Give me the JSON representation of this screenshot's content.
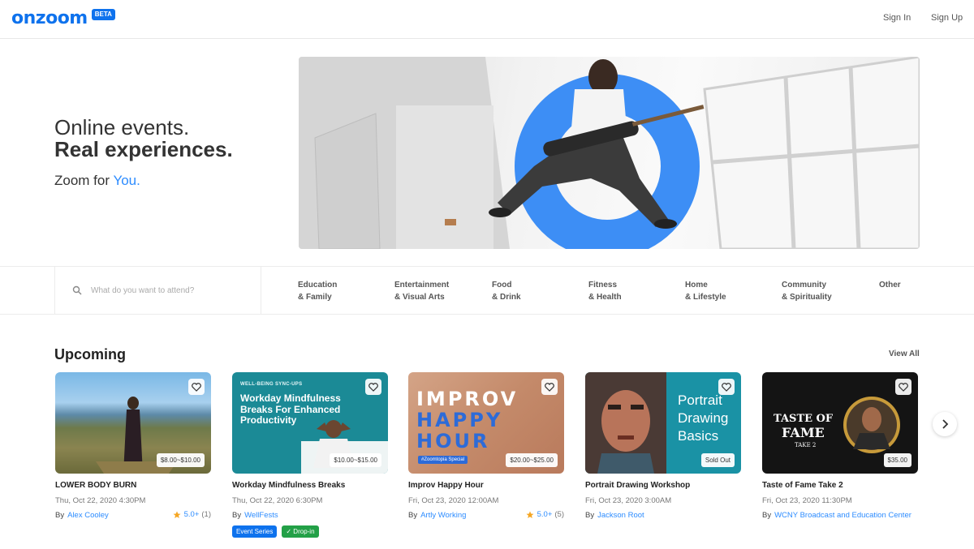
{
  "header": {
    "logo": "onzoom",
    "beta": "BETA",
    "sign_in": "Sign In",
    "sign_up": "Sign Up"
  },
  "hero": {
    "line1": "Online events.",
    "line2": "Real experiences.",
    "sub_prefix": "Zoom for ",
    "sub_accent": "You."
  },
  "search": {
    "placeholder": "What do you want to attend?"
  },
  "categories": [
    {
      "line1": "Education",
      "line2": "& Family"
    },
    {
      "line1": "Entertainment",
      "line2": "& Visual Arts"
    },
    {
      "line1": "Food",
      "line2": "& Drink"
    },
    {
      "line1": "Fitness",
      "line2": "& Health"
    },
    {
      "line1": "Home",
      "line2": "& Lifestyle"
    },
    {
      "line1": "Community",
      "line2": "& Spirituality"
    },
    {
      "line1": "Other",
      "line2": ""
    }
  ],
  "upcoming": {
    "title": "Upcoming",
    "view_all": "View All"
  },
  "events": [
    {
      "title": "LOWER BODY BURN",
      "date": "Thu, Oct 22, 2020 4:30PM",
      "by": "By",
      "host": "Alex Cooley",
      "price": "$8.00~$10.00",
      "rating": "5.0+",
      "rating_count": "(1)"
    },
    {
      "title": "Workday Mindfulness Breaks",
      "date": "Thu, Oct 22, 2020 6:30PM",
      "by": "By",
      "host": "WellFests",
      "price": "$10.00~$15.00",
      "thumb_tag": "WELL-BEING SYNC-UPS",
      "thumb_title": "Workday Mindfulness Breaks For Enhanced Productivity",
      "tag1": "Event Series",
      "tag2": "Drop-in"
    },
    {
      "title": "Improv Happy Hour",
      "date": "Fri, Oct 23, 2020 12:00AM",
      "by": "By",
      "host": "Artly Working",
      "price": "$20.00~$25.00",
      "rating": "5.0+",
      "rating_count": "(5)",
      "thumb_line1": "IMPROV",
      "thumb_line2": "HAPPY",
      "thumb_line3": "HOUR",
      "thumb_badge": "#Zoomtopia Special"
    },
    {
      "title": "Portrait Drawing Workshop",
      "date": "Fri, Oct 23, 2020 3:00AM",
      "by": "By",
      "host": "Jackson Root",
      "status": "Sold Out",
      "thumb_text": "Portrait Drawing Basics"
    },
    {
      "title": "Taste of Fame Take 2",
      "date": "Fri, Oct 23, 2020 11:30PM",
      "by": "By",
      "host": "WCNY Broadcast and Education Center",
      "price": "$35.00",
      "thumb_line1": "TASTE OF",
      "thumb_line2": "FAME",
      "thumb_line3": "TAKE 2"
    }
  ],
  "colors": {
    "brand": "#0e72ed",
    "accent": "#2d8cff",
    "star": "#f5a623",
    "drop_in": "#23a047"
  }
}
